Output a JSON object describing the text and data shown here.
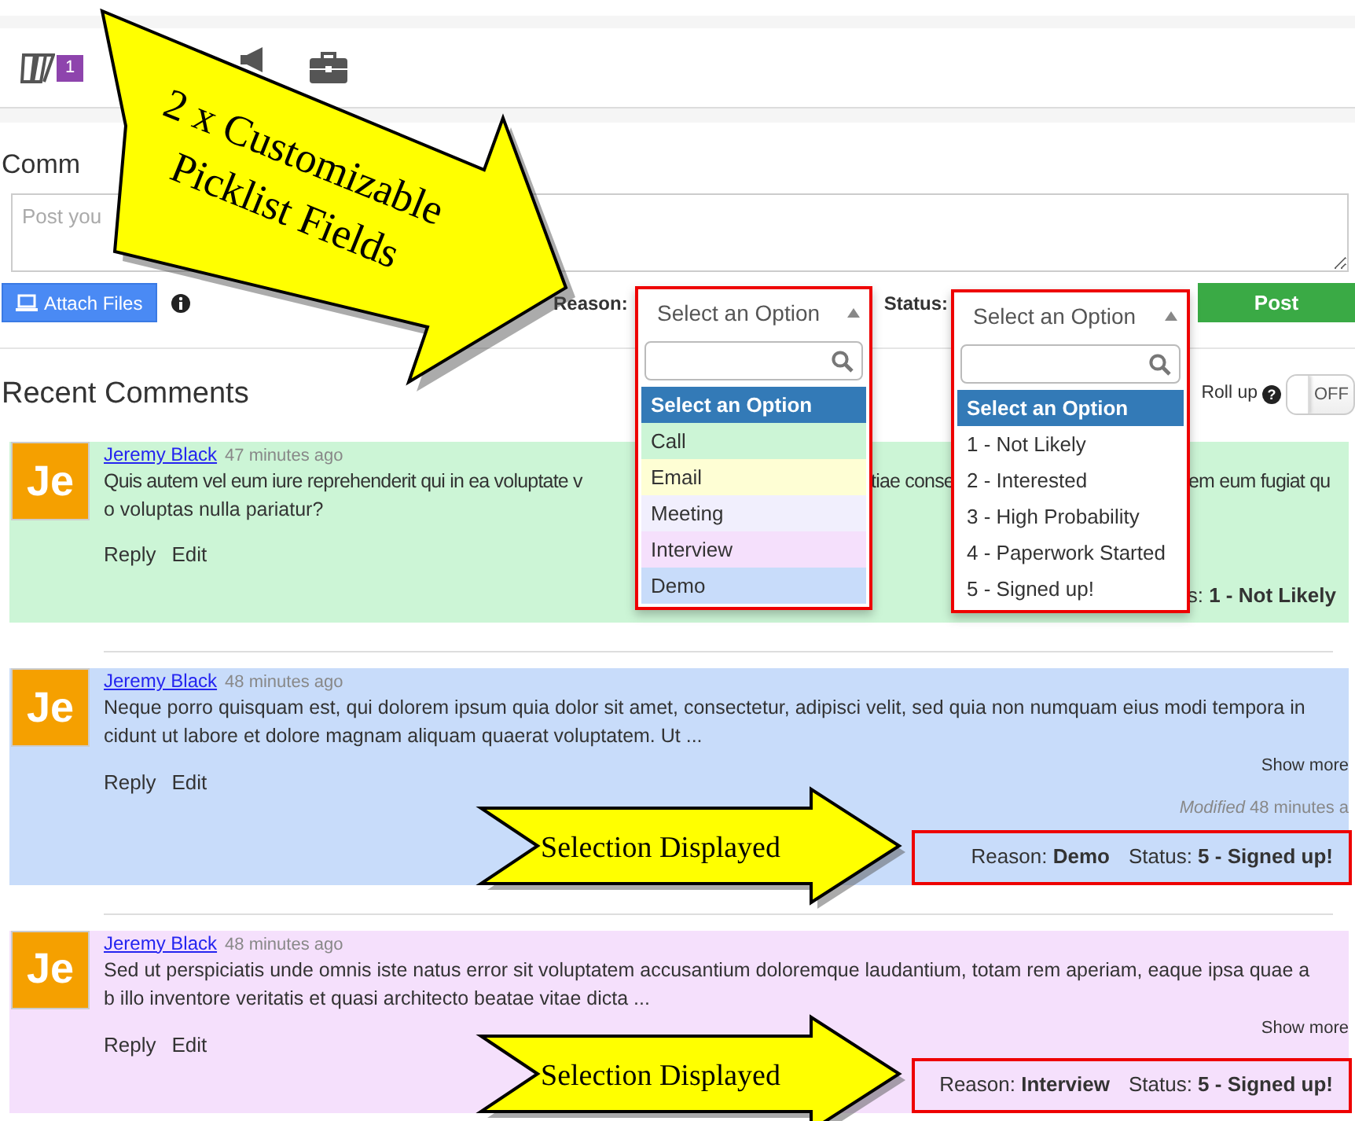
{
  "toolbar": {
    "icons": [
      {
        "kind": "cards",
        "badge": "1"
      },
      {
        "kind": "megaphone"
      },
      {
        "kind": "briefcase"
      }
    ]
  },
  "callout": {
    "lines": [
      "2 x Customizable",
      "Picklist Fields"
    ]
  },
  "composer": {
    "title": "Comm",
    "placeholder": "Post you",
    "attach_button": "Attach Files",
    "post_button": "Post",
    "pickers": [
      {
        "label": "Reason:",
        "value": "Select an Option",
        "expanded": true,
        "highlighted": true,
        "options": [
          {
            "label": "Select an Option",
            "selected": true
          },
          {
            "label": "Call",
            "selected": false,
            "color": "#ccf5d6"
          },
          {
            "label": "Email",
            "selected": false,
            "color": "#fefed4"
          },
          {
            "label": "Meeting",
            "selected": false,
            "color": "#f1effd"
          },
          {
            "label": "Interview",
            "selected": false,
            "color": "#f5e0fc"
          },
          {
            "label": "Demo",
            "selected": false,
            "color": "#c8dcfa"
          }
        ]
      },
      {
        "label": "Status:",
        "value": "Select an Option",
        "expanded": true,
        "highlighted": true,
        "options": [
          {
            "label": "Select an Option",
            "selected": true
          },
          {
            "label": "1 - Not Likely",
            "selected": false
          },
          {
            "label": "2 - Interested",
            "selected": false
          },
          {
            "label": "3 - High Probability",
            "selected": false
          },
          {
            "label": "4 - Paperwork Started",
            "selected": false
          },
          {
            "label": "5 - Signed up!",
            "selected": false
          }
        ]
      }
    ]
  },
  "comments_section": {
    "title": "Recent Comments",
    "rollup_label": "Roll up",
    "help_icon": "?",
    "toggle": {
      "label": "OFF",
      "on": false
    }
  },
  "comments": [
    {
      "avatar": "Je",
      "author": "Jeremy Black",
      "time": "47 minutes ago",
      "color": "#ccf5d6",
      "lines": [
        [
          "Quis autem vel eum iure reprehenderit qui in ea voluptate v",
          "tiae conse",
          "em eum fugiat qu"
        ],
        [
          "o voluptas nulla pariatur?"
        ]
      ],
      "actions": [
        "Reply",
        "Edit"
      ],
      "status_label": "s:",
      "status": "1 - Not Likely",
      "highlighted": false
    },
    {
      "avatar": "Je",
      "author": "Jeremy Black",
      "time": "48 minutes ago",
      "color": "#c8dcfa",
      "lines": [
        [
          "Neque porro quisquam est, qui dolorem ipsum quia dolor sit amet, consectetur, adipisci velit, sed quia non numquam eius modi tempora in"
        ],
        [
          "cidunt ut labore et dolore magnam aliquam quaerat voluptatem. Ut ..."
        ]
      ],
      "show_more": "Show more",
      "actions": [
        "Reply",
        "Edit"
      ],
      "modified_label": "Modified",
      "modified_time": "48 minutes a",
      "reason_label": "Reason:",
      "reason": "Demo",
      "status_label": "Status:",
      "status": "5 - Signed up!",
      "highlighted": true,
      "callout": "Selection Displayed"
    },
    {
      "avatar": "Je",
      "author": "Jeremy Black",
      "time": "48 minutes ago",
      "color": "#f5e0fc",
      "lines": [
        [
          "Sed ut perspiciatis unde omnis iste natus error sit voluptatem accusantium doloremque laudantium, totam rem aperiam, eaque ipsa quae a"
        ],
        [
          "b illo inventore veritatis et quasi architecto beatae vitae dicta ..."
        ]
      ],
      "show_more": "Show more",
      "actions": [
        "Reply",
        "Edit"
      ],
      "reason_label": "Reason:",
      "reason": "Interview",
      "status_label": "Status:",
      "status": "5 - Signed up!",
      "highlighted": true,
      "callout": "Selection Displayed"
    }
  ]
}
